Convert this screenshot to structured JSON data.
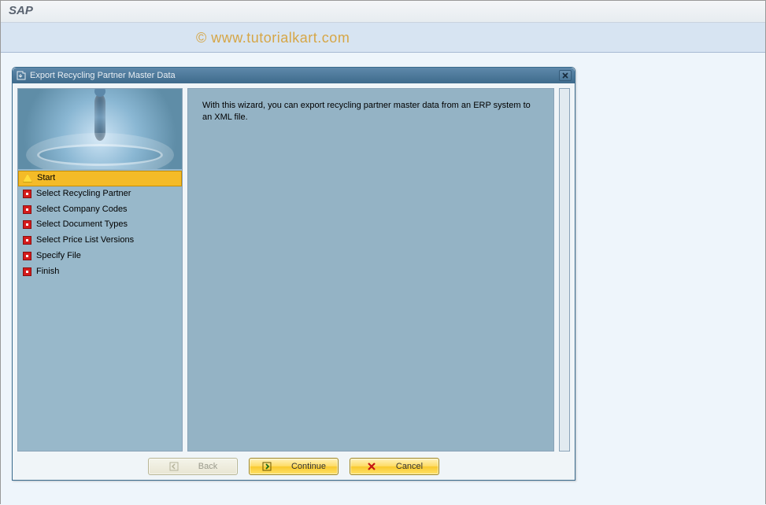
{
  "header": {
    "title": "SAP"
  },
  "watermark": "© www.tutorialkart.com",
  "dialog": {
    "title": "Export Recycling Partner Master Data",
    "description": "With this wizard, you can export recycling partner master data from an ERP system to an XML file.",
    "steps": [
      {
        "label": "Start",
        "state": "active"
      },
      {
        "label": "Select Recycling Partner",
        "state": "pending"
      },
      {
        "label": "Select Company Codes",
        "state": "pending"
      },
      {
        "label": "Select Document Types",
        "state": "pending"
      },
      {
        "label": "Select Price List Versions",
        "state": "pending"
      },
      {
        "label": "Specify File",
        "state": "pending"
      },
      {
        "label": "Finish",
        "state": "pending"
      }
    ],
    "buttons": {
      "back": "Back",
      "continue": "Continue",
      "cancel": "Cancel"
    }
  }
}
